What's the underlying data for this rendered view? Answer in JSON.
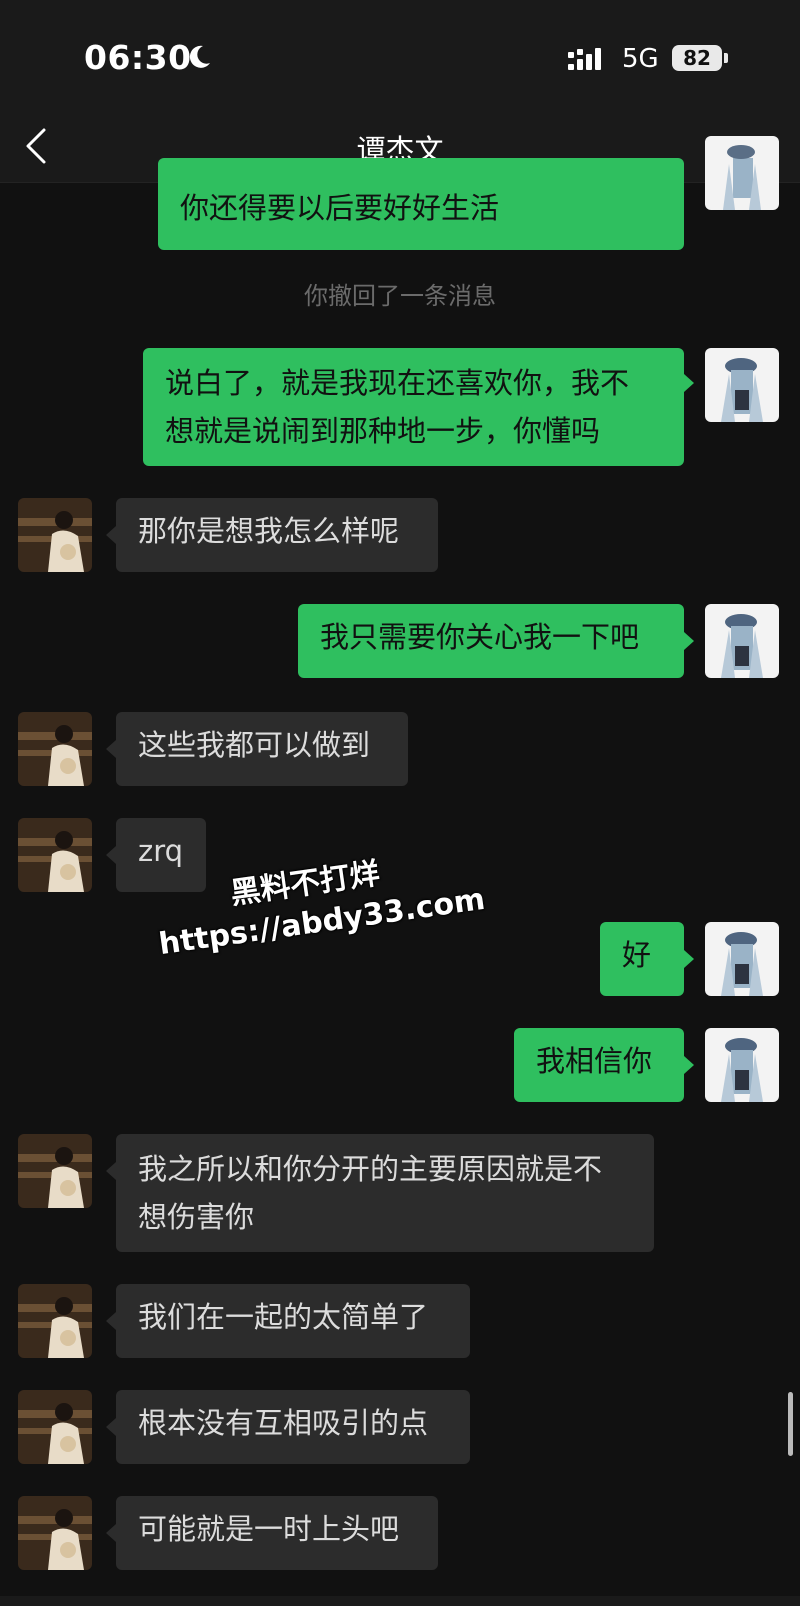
{
  "status_bar": {
    "time": "06:30",
    "network": "5G",
    "battery": "82",
    "moon_icon": "moon-icon",
    "signal_icon": "signal-icon"
  },
  "nav": {
    "title": "谭杰文",
    "back_icon": "chevron-left-icon",
    "more_icon": "more-horizontal-icon"
  },
  "messages": [
    {
      "side": "sent",
      "text": "你还得要以后要好好生活"
    },
    {
      "side": "system",
      "text": "你撤回了一条消息"
    },
    {
      "side": "sent",
      "text": "说白了，就是我现在还喜欢你，我不\n想就是说闹到那种地一步，你懂吗"
    },
    {
      "side": "received",
      "text": "那你是想我怎么样呢"
    },
    {
      "side": "sent",
      "text": "我只需要你关心我一下吧"
    },
    {
      "side": "received",
      "text": "这些我都可以做到"
    },
    {
      "side": "received",
      "text": "zrq"
    },
    {
      "side": "sent",
      "text": "好"
    },
    {
      "side": "sent",
      "text": "我相信你"
    },
    {
      "side": "received",
      "text": "我之所以和你分开的主要原因就是不\n想伤害你"
    },
    {
      "side": "received",
      "text": "我们在一起的太简单了"
    },
    {
      "side": "received",
      "text": "根本没有互相吸引的点"
    },
    {
      "side": "received",
      "text": "可能就是一时上头吧"
    }
  ],
  "watermark": {
    "line1": "黑料不打烊",
    "line2": "https://abdy33.com"
  },
  "colors": {
    "background": "#111111",
    "sent_bubble": "#2fbf5f",
    "received_bubble": "#2c2c2c",
    "system_text": "#6b6b6b"
  }
}
